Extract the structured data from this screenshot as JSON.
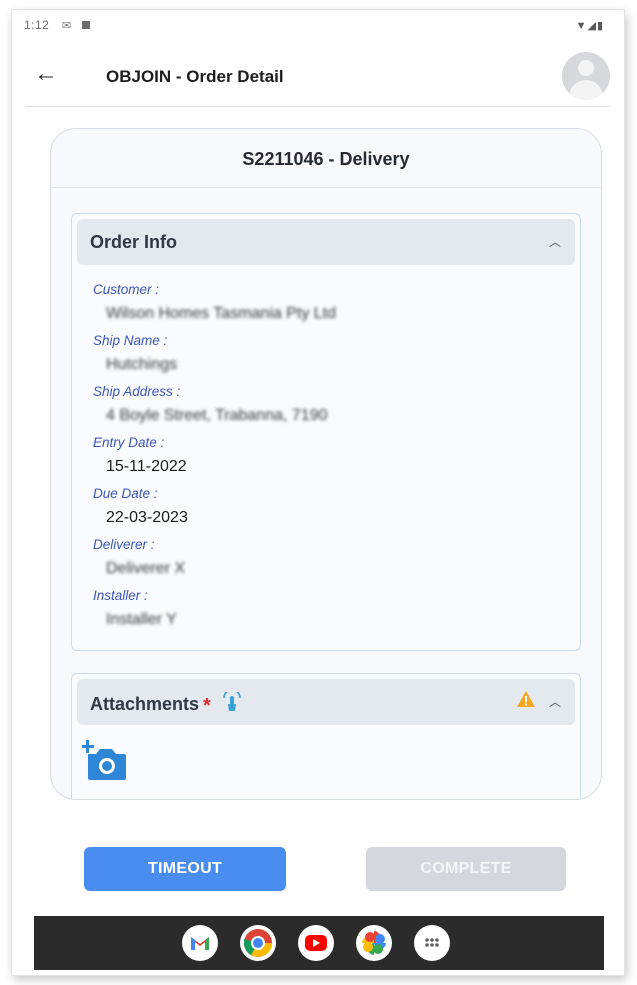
{
  "status_bar": {
    "time": "1:12",
    "left_icons": [
      "mail-icon",
      "square-icon"
    ],
    "right_icons": "▼◢▮"
  },
  "app_bar": {
    "title": "OBJOIN - Order Detail",
    "back_icon": "arrow-left-icon",
    "avatar_icon": "user-avatar-icon"
  },
  "order": {
    "header": "S2211046 - Delivery",
    "info_section": {
      "title": "Order Info",
      "fields": [
        {
          "label": "Customer :",
          "value": "Wilson Homes Tasmania Pty Ltd"
        },
        {
          "label": "Ship Name :",
          "value": "Hutchings"
        },
        {
          "label": "Ship Address :",
          "value": "4 Boyle Street, Trabanna, 7190"
        },
        {
          "label": "Entry Date :",
          "value": "15-11-2022"
        },
        {
          "label": "Due Date :",
          "value": "22-03-2023"
        },
        {
          "label": "Deliverer :",
          "value": "Deliverer X"
        },
        {
          "label": "Installer :",
          "value": "Installer Y"
        }
      ]
    },
    "attachments_section": {
      "title": "Attachments",
      "required_mark": "*"
    }
  },
  "buttons": {
    "timeout": "TIMEOUT",
    "complete": "COMPLETE"
  },
  "colors": {
    "primary": "#4a8df0",
    "label": "#3c56b8",
    "required": "#e02b2b",
    "warning": "#f5a623",
    "disabled": "#d4d8de"
  },
  "nav_apps": [
    "gmail-icon",
    "chrome-icon",
    "youtube-icon",
    "photos-icon",
    "app-drawer-icon"
  ]
}
